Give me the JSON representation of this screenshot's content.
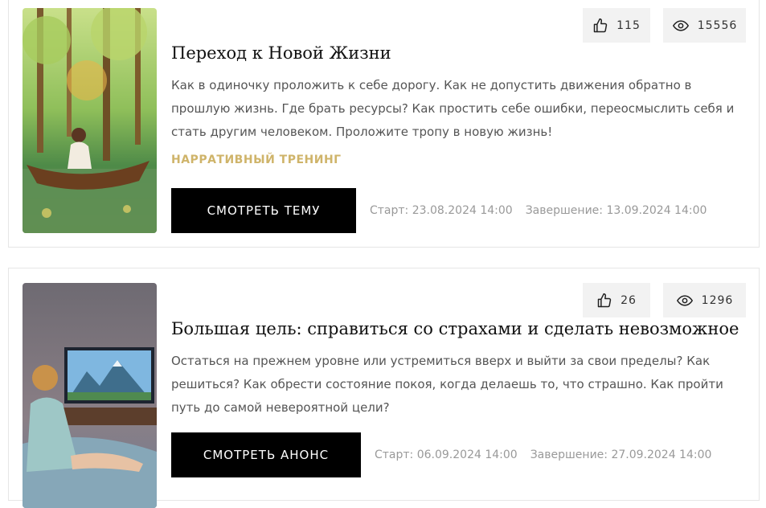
{
  "cards": [
    {
      "likes": "115",
      "views": "15556",
      "title": "Переход к Новой Жизни",
      "description": "Как в одиночку проложить к себе дорогу. Как не допустить движения обратно в прошлую жизнь. Где брать ресурсы? Как простить себе ошибки, переосмыслить себя и стать другим человеком. Проложите тропу в новую жизнь!",
      "tag": "НАРРАТИВНЫЙ ТРЕНИНГ",
      "button_label": "СМОТРЕТЬ ТЕМУ",
      "start": "Старт: 23.08.2024 14:00",
      "end": "Завершение: 13.09.2024 14:00"
    },
    {
      "likes": "26",
      "views": "1296",
      "title": "Большая цель: справиться со страхами и сделать невозможное",
      "description": "Остаться на прежнем уровне или устремиться вверх и выйти за свои пределы? Как решиться? Как обрести состояние покоя, когда делаешь то, что страшно. Как пройти путь до самой невероятной цели?",
      "button_label": "СМОТРЕТЬ АНОНС",
      "start": "Старт: 06.09.2024 14:00",
      "end": "Завершение: 27.09.2024 14:00"
    }
  ],
  "icons": {
    "likes": "thumbs-up-icon",
    "views": "eye-icon"
  }
}
